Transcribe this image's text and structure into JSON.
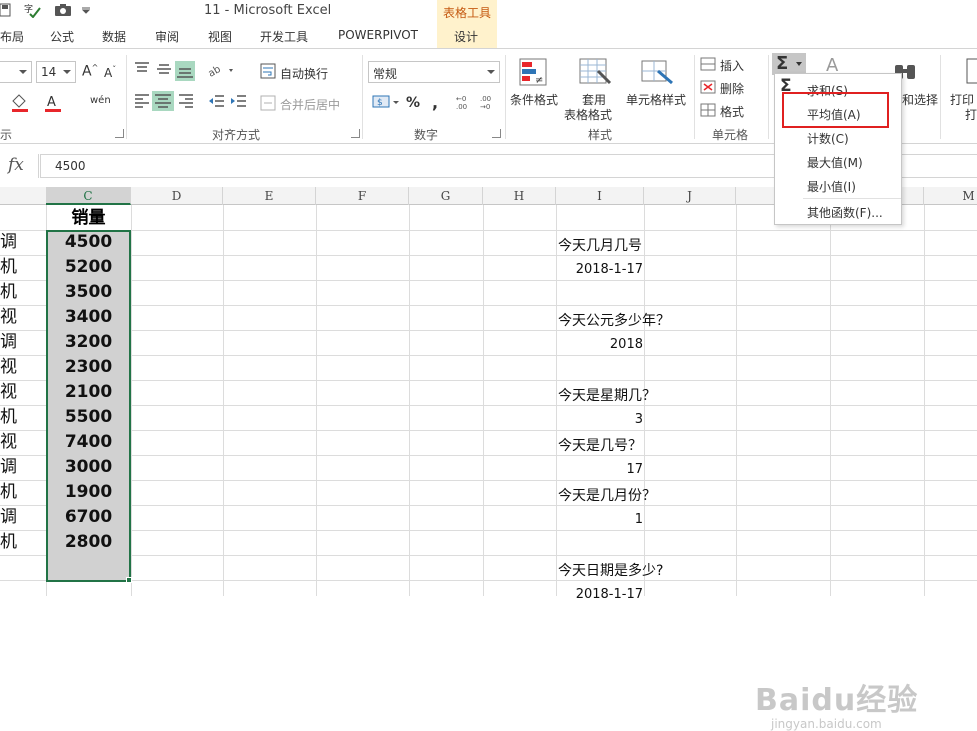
{
  "title_bar": {
    "title": "11 - Microsoft Excel",
    "context_group": "表格工具"
  },
  "tabs": [
    "布局",
    "公式",
    "数据",
    "审阅",
    "视图",
    "开发工具",
    "POWERPIVOT",
    "设计"
  ],
  "ribbon": {
    "font_size": "14",
    "wrap_text": "自动换行",
    "merge_center": "合并后居中",
    "number_format": "常规",
    "align_group_label": "对齐方式",
    "number_group_label": "数字",
    "styles_group_label": "样式",
    "cells_group_label": "单元格",
    "font_group_label_partial": "示",
    "conditional_format": "条件格式",
    "table_format_1": "套用",
    "table_format_2": "表格格式",
    "cell_style": "单元格样式",
    "insert": "插入",
    "delete": "删除",
    "format": "格式",
    "find_select": "和选择",
    "print_1": "打印",
    "print_2": "打"
  },
  "autosum_menu": {
    "items": [
      "求和(S)",
      "平均值(A)",
      "计数(C)",
      "最大值(M)",
      "最小值(I)",
      "其他函数(F)..."
    ],
    "highlight_color": "#e02020"
  },
  "formula_bar": {
    "value": "4500"
  },
  "columns": [
    "C",
    "D",
    "E",
    "F",
    "G",
    "H",
    "I",
    "J",
    "M"
  ],
  "sheet": {
    "c_header": "销量",
    "sales": [
      "4500",
      "5200",
      "3500",
      "3400",
      "3200",
      "2300",
      "2100",
      "5500",
      "7400",
      "3000",
      "1900",
      "6700",
      "2800"
    ],
    "col_b_partial": [
      "调",
      "机",
      "机",
      "视",
      "调",
      "视",
      "视",
      "机",
      "视",
      "调",
      "机",
      "调",
      "机"
    ],
    "questions": [
      {
        "q": "今天几月几号",
        "a": "2018-1-17"
      },
      {
        "q": "今天公元多少年？",
        "a": "2018"
      },
      {
        "q": "今天是星期几？",
        "a": "3"
      },
      {
        "q": "今天是几号？",
        "a": "17"
      },
      {
        "q": "今天是几月份？",
        "a": "1"
      },
      {
        "q": "今天日期是多少?",
        "a": "2018-1-17"
      }
    ]
  },
  "watermark": {
    "brand": "Baidu经验",
    "url": "jingyan.baidu.com"
  },
  "accent_color": "#217346"
}
